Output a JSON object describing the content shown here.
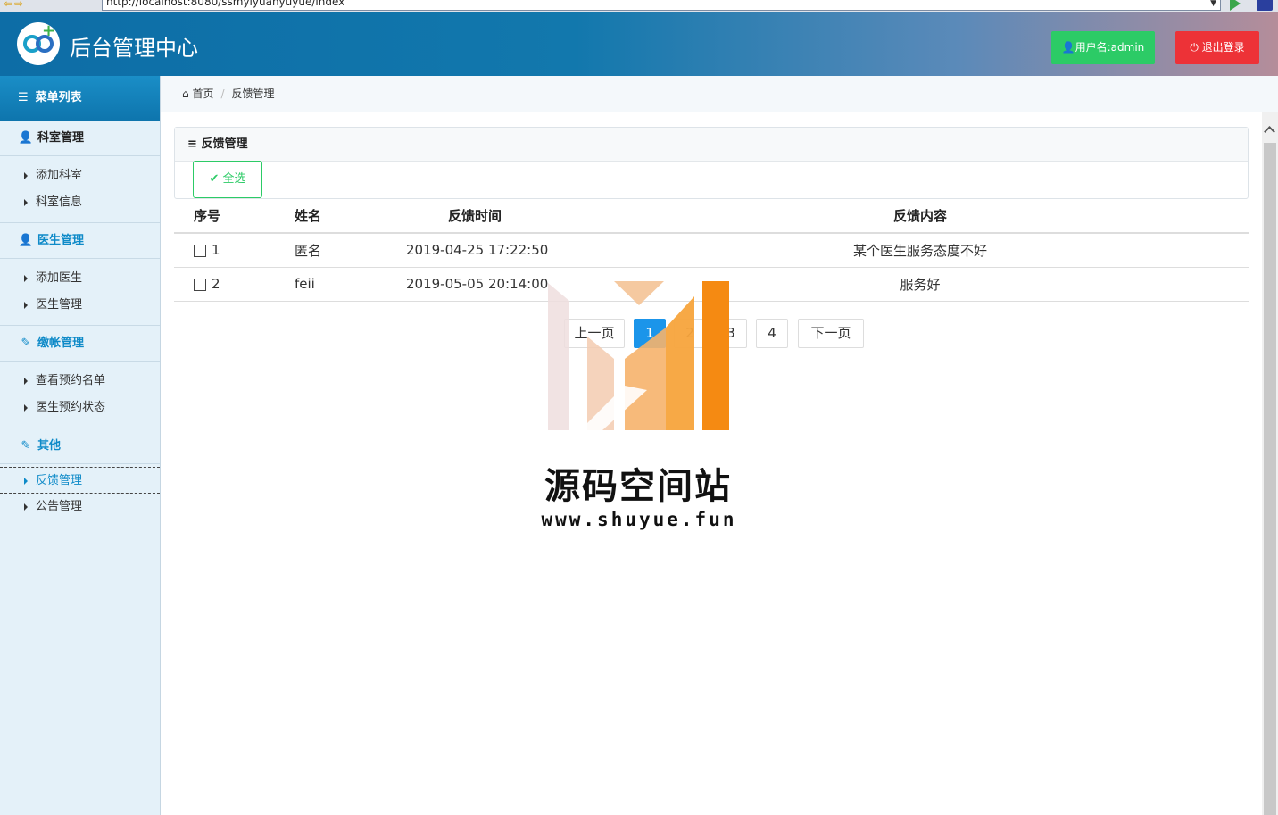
{
  "browser": {
    "url": "http://localhost:8080/ssmyiyuanyuyue/index"
  },
  "header": {
    "title": "后台管理中心",
    "user_label": "用户名:admin",
    "logout_label": "退出登录"
  },
  "sidebar": {
    "menu_title": "菜单列表",
    "groups": [
      {
        "title": "科室管理",
        "items": [
          "添加科室",
          "科室信息"
        ]
      },
      {
        "title": "医生管理",
        "items": [
          "添加医生",
          "医生管理"
        ]
      },
      {
        "title": "缴帐管理",
        "items": [
          "查看预约名单",
          "医生预约状态"
        ]
      },
      {
        "title": "其他",
        "items": [
          "反馈管理",
          "公告管理"
        ]
      }
    ],
    "active_item": "反馈管理"
  },
  "breadcrumb": {
    "home": "首页",
    "current": "反馈管理"
  },
  "panel": {
    "title": "反馈管理",
    "select_all_label": "全选"
  },
  "table": {
    "headers": [
      "序号",
      "姓名",
      "反馈时间",
      "反馈内容"
    ],
    "rows": [
      {
        "no": "1",
        "name": "匿名",
        "time": "2019-04-25 17:22:50",
        "content": "某个医生服务态度不好"
      },
      {
        "no": "2",
        "name": "feii",
        "time": "2019-05-05 20:14:00",
        "content": "服务好"
      }
    ]
  },
  "pagination": {
    "prev_label": "上一页",
    "pages": [
      "1",
      "2",
      "3",
      "4"
    ],
    "current_page": "1",
    "next_label": "下一页"
  },
  "watermark": {
    "title": "源码空间站",
    "url": "www.shuyue.fun"
  },
  "colors": {
    "header_start": "#0d6da6",
    "accent_blue": "#0e8ac8",
    "green": "#2ccb66",
    "red": "#ed3237",
    "active_page": "#1b95ea",
    "sidebar_bg": "#e4f1f9"
  }
}
